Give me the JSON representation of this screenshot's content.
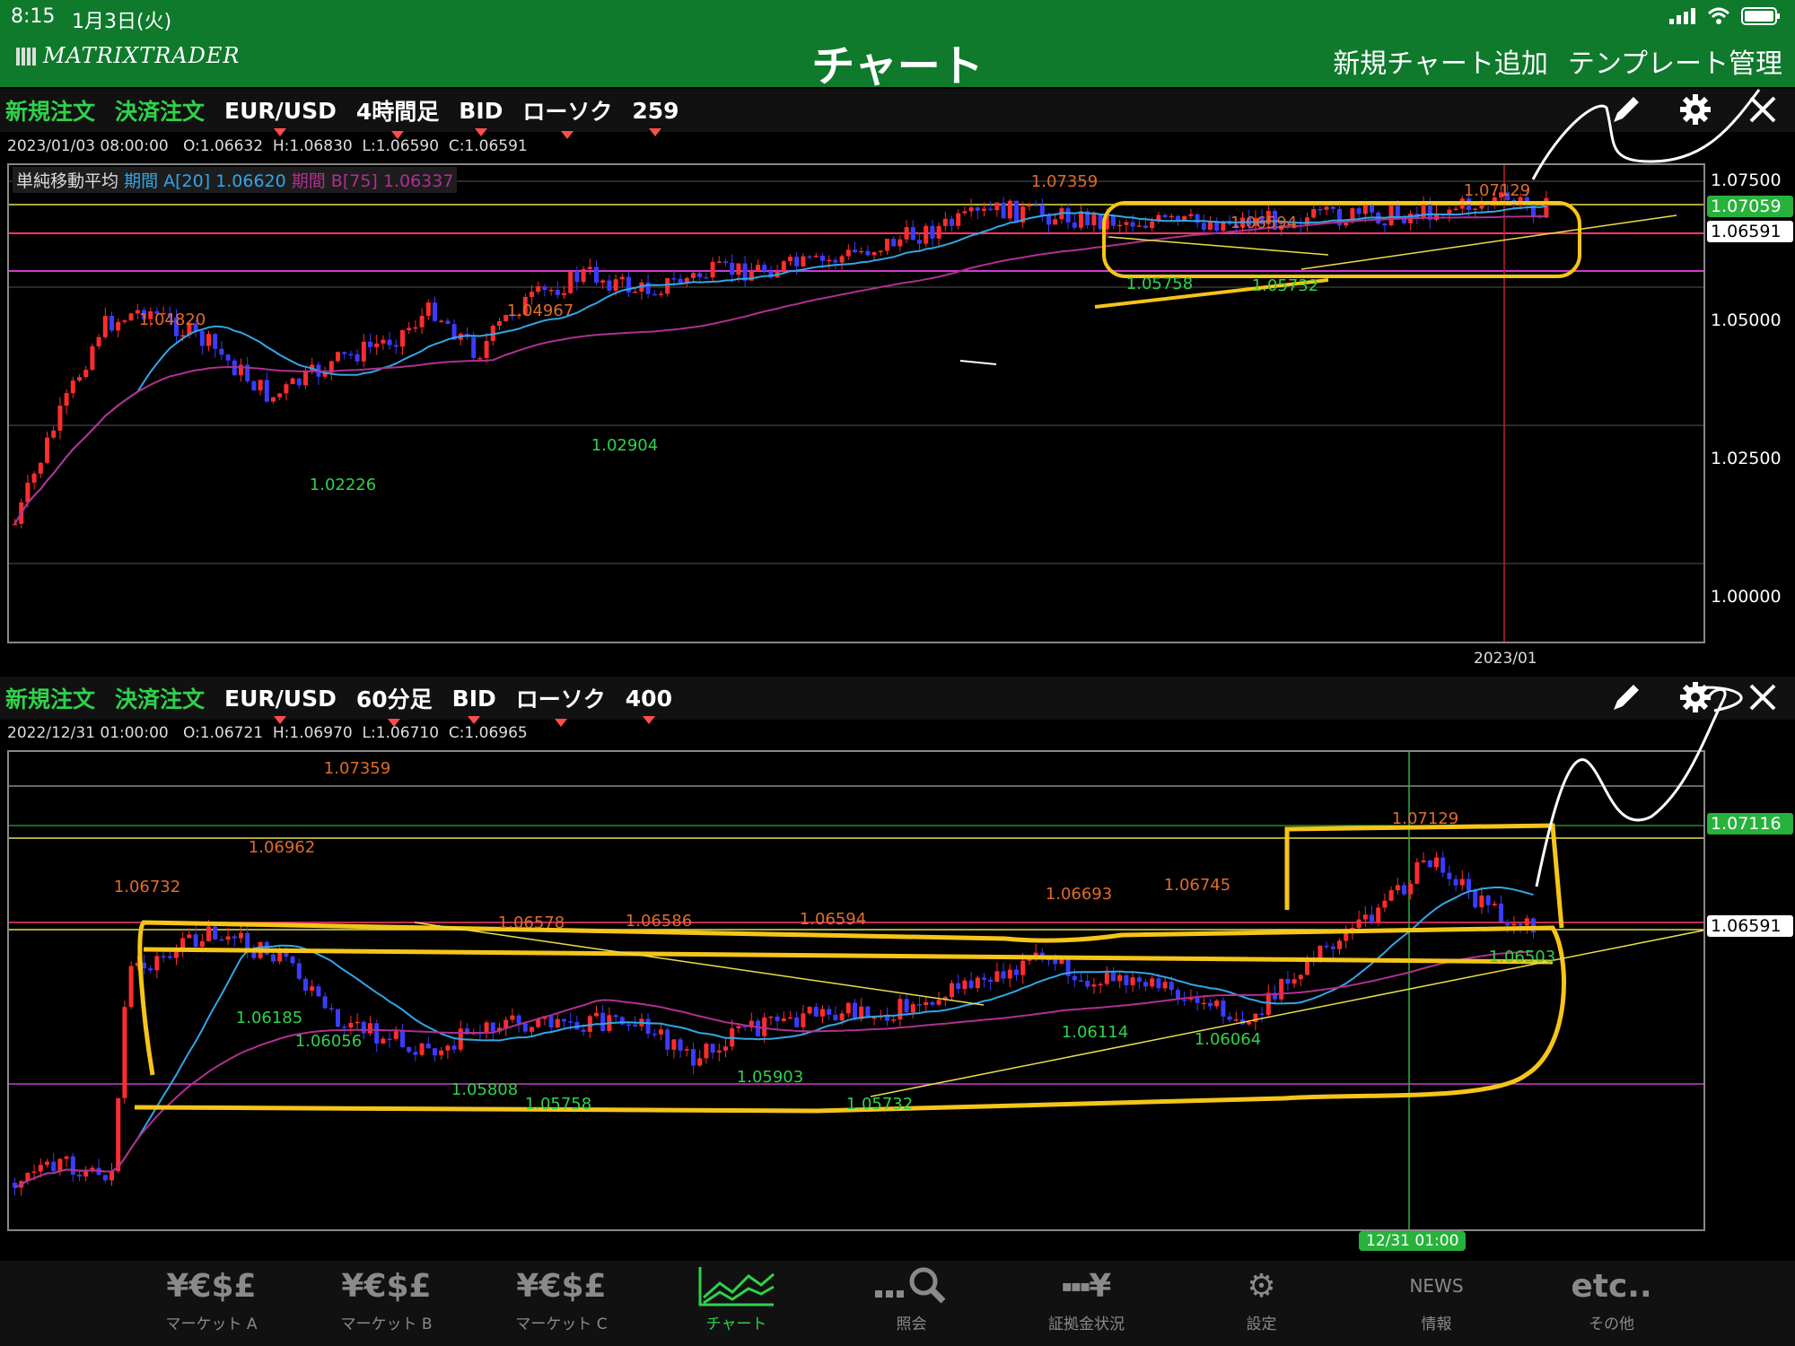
{
  "status": {
    "time": "8:15",
    "date": "1月3日(火)"
  },
  "header": {
    "logo": "MATRIXTRADER",
    "title": "チャート",
    "add_chart": "新規チャート追加",
    "template_manage": "テンプレート管理"
  },
  "panel1": {
    "toolbar": {
      "new_order": "新規注文",
      "settle_order": "決済注文",
      "pair": "EUR/USD",
      "timeframe": "4時間足",
      "price_type": "BID",
      "chart_type": "ローソク",
      "count": "259"
    },
    "ohlc": {
      "datetime": "2023/01/03 08:00:00",
      "o": "O:1.06632",
      "h": "H:1.06830",
      "l": "L:1.06590",
      "c": "C:1.06591"
    },
    "legend": {
      "name": "単純移動平均",
      "period_a": "期間 A[20] 1.06620",
      "period_b": "期間 B[75] 1.06337"
    },
    "y_ticks": [
      "1.07500",
      "1.05000",
      "1.02500",
      "1.00000"
    ],
    "badge_green": "1.07059",
    "badge_white": "1.06591",
    "date_label": "2023/01",
    "annotations": [
      "1.07359",
      "1.07129",
      "1.06594",
      "1.04820",
      "1.04967",
      "1.05758",
      "1.05732",
      "1.02904",
      "1.02226"
    ]
  },
  "panel2": {
    "toolbar": {
      "new_order": "新規注文",
      "settle_order": "決済注文",
      "pair": "EUR/USD",
      "timeframe": "60分足",
      "price_type": "BID",
      "chart_type": "ローソク",
      "count": "400"
    },
    "ohlc": {
      "datetime": "2022/12/31 01:00:00",
      "o": "O:1.06721",
      "h": "H:1.06970",
      "l": "L:1.06710",
      "c": "C:1.06965"
    },
    "badge_green": "1.07116",
    "badge_white": "1.06591",
    "date_label": "12/31 01:00",
    "annotations": [
      "1.07359",
      "1.06962",
      "1.06732",
      "1.07129",
      "1.06578",
      "1.06586",
      "1.06594",
      "1.06693",
      "1.06745",
      "1.06185",
      "1.06056",
      "1.05808",
      "1.05758",
      "1.05903",
      "1.05732",
      "1.06114",
      "1.06064",
      "1.06503"
    ]
  },
  "tabs": [
    {
      "icon": "¥€$£",
      "label": "マーケット A"
    },
    {
      "icon": "¥€$£",
      "label": "マーケット B"
    },
    {
      "icon": "¥€$£",
      "label": "マーケット C"
    },
    {
      "icon": "chart",
      "label": "チャート"
    },
    {
      "icon": "search",
      "label": "照会"
    },
    {
      "icon": "¥",
      "label": "証拠金状況"
    },
    {
      "icon": "gear",
      "label": "設定"
    },
    {
      "icon": "NEWS",
      "label": "情報"
    },
    {
      "icon": "etc..",
      "label": "その他"
    }
  ],
  "colors": {
    "header_green": "#0f7a2c",
    "accent_green": "#2fd24a",
    "bull": "#ff2d2d",
    "bear": "#3b3bff",
    "ma_a": "#33a6e6",
    "ma_b": "#b0308f",
    "highlight": "#f5c518"
  }
}
